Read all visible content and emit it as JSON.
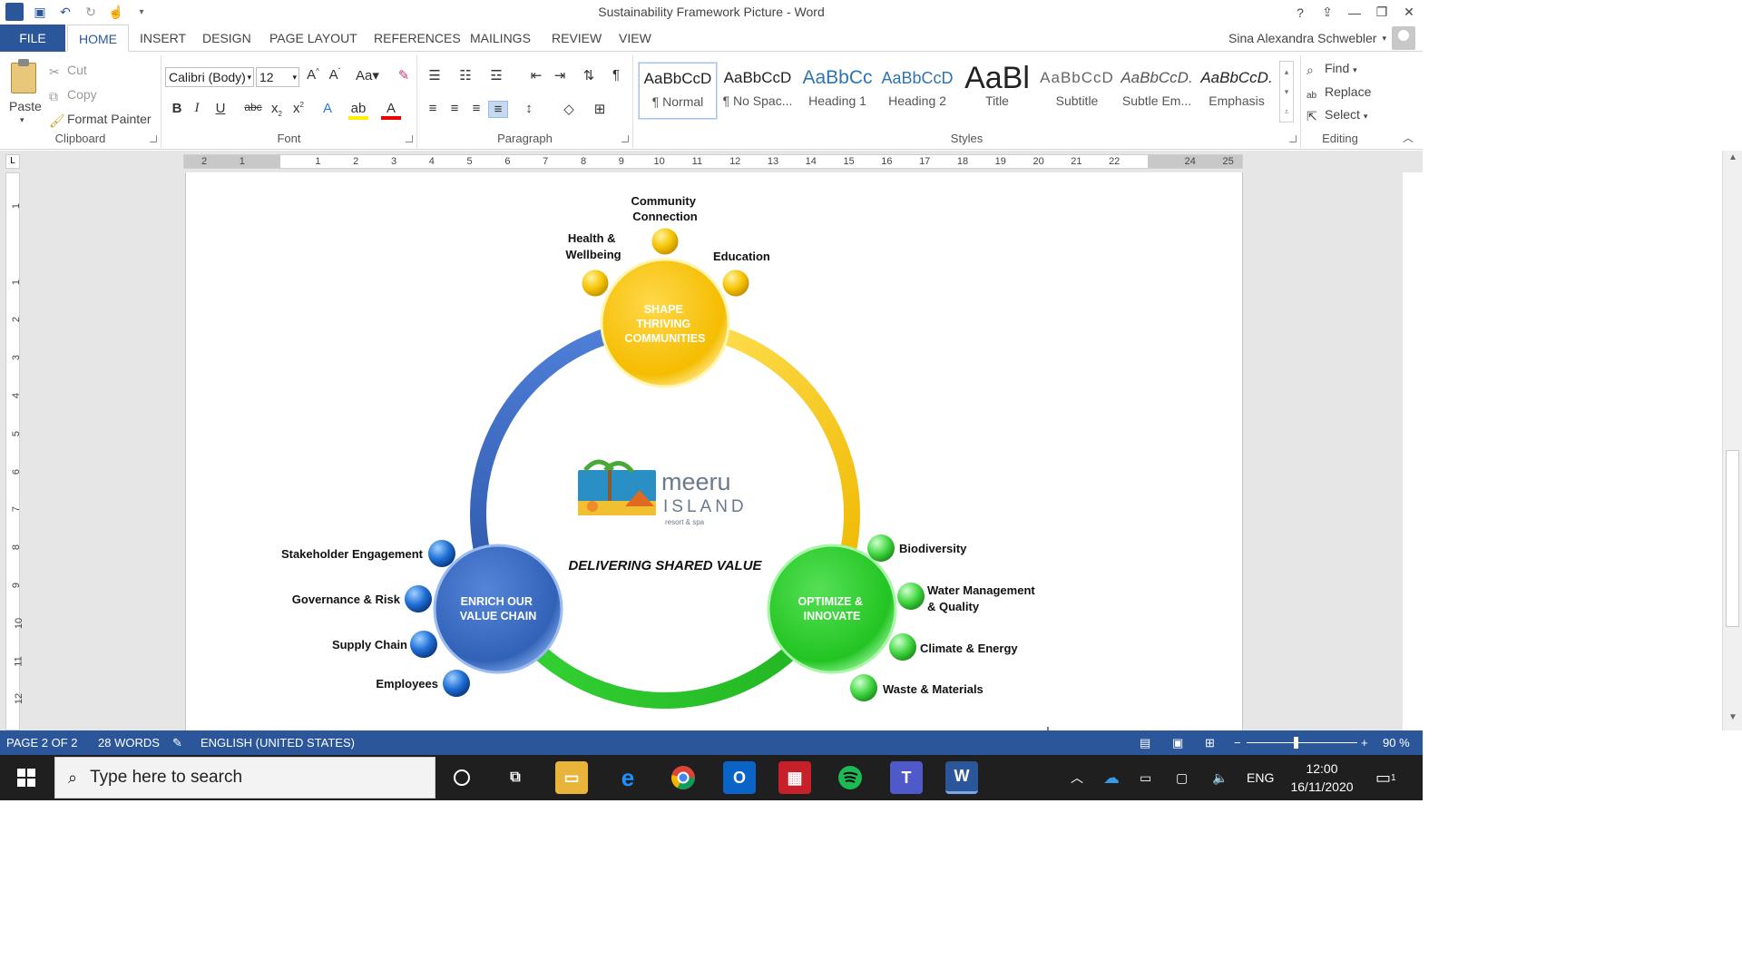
{
  "window": {
    "title": "Sustainability Framework Picture - Word",
    "user": "Sina Alexandra Schwebler"
  },
  "tabs": [
    "FILE",
    "HOME",
    "INSERT",
    "DESIGN",
    "PAGE LAYOUT",
    "REFERENCES",
    "MAILINGS",
    "REVIEW",
    "VIEW"
  ],
  "clipboard": {
    "paste": "Paste",
    "cut": "Cut",
    "copy": "Copy",
    "format_painter": "Format Painter",
    "label": "Clipboard"
  },
  "font": {
    "name": "Calibri (Body)",
    "size": "12",
    "label": "Font",
    "change_case": "Aa"
  },
  "paragraph": {
    "label": "Paragraph"
  },
  "styles": {
    "label": "Styles",
    "items": [
      {
        "sample": "AaBbCcD",
        "name": "¶ Normal"
      },
      {
        "sample": "AaBbCcD",
        "name": "¶ No Spac..."
      },
      {
        "sample": "AaBbCc",
        "name": "Heading 1"
      },
      {
        "sample": "AaBbCcD",
        "name": "Heading 2"
      },
      {
        "sample": "AaBl",
        "name": "Title"
      },
      {
        "sample": "AaBbCcD",
        "name": "Subtitle"
      },
      {
        "sample": "AaBbCcD.",
        "name": "Subtle Em..."
      },
      {
        "sample": "AaBbCcD.",
        "name": "Emphasis"
      }
    ]
  },
  "editing": {
    "label": "Editing",
    "find": "Find",
    "replace": "Replace",
    "select": "Select"
  },
  "ruler": {
    "marks": [
      "2",
      "1",
      "",
      "1",
      "2",
      "3",
      "4",
      "5",
      "6",
      "7",
      "8",
      "9",
      "10",
      "11",
      "12",
      "13",
      "14",
      "15",
      "16",
      "17",
      "18",
      "19",
      "20",
      "21",
      "22",
      "",
      "24",
      "25"
    ],
    "vmarks": [
      "1",
      "",
      "1",
      "2",
      "3",
      "4",
      "5",
      "6",
      "7",
      "8",
      "9",
      "10",
      "11",
      "12"
    ]
  },
  "diagram": {
    "center_title": "DELIVERING SHARED VALUE",
    "logo_line1": "meeru",
    "logo_line2": "ISLAND",
    "logo_line3": "resort & spa",
    "hubs": {
      "top": [
        "SHAPE",
        "THRIVING",
        "COMMUNITIES"
      ],
      "left": [
        "ENRICH OUR",
        "VALUE CHAIN"
      ],
      "right": [
        "OPTIMIZE &",
        "INNOVATE"
      ]
    },
    "top_items": [
      [
        "Community",
        "Connection"
      ],
      [
        "Health &",
        "Wellbeing"
      ],
      [
        "Education"
      ]
    ],
    "left_items": [
      "Stakeholder Engagement",
      "Governance & Risk",
      "Supply Chain",
      "Employees"
    ],
    "right_items": [
      [
        "Biodiversity"
      ],
      [
        "Water Management",
        "& Quality"
      ],
      [
        "Climate & Energy"
      ],
      [
        "Waste & Materials"
      ]
    ],
    "colors": {
      "yellow": "#f5c400",
      "blue": "#3b6fc4",
      "green": "#3fd13f"
    }
  },
  "status": {
    "page": "PAGE 2 OF 2",
    "words": "28 WORDS",
    "language": "ENGLISH (UNITED STATES)",
    "zoom": "90 %"
  },
  "taskbar": {
    "search_placeholder": "Type here to search",
    "lang": "ENG",
    "time": "12:00",
    "date": "16/11/2020",
    "notif": "1"
  }
}
